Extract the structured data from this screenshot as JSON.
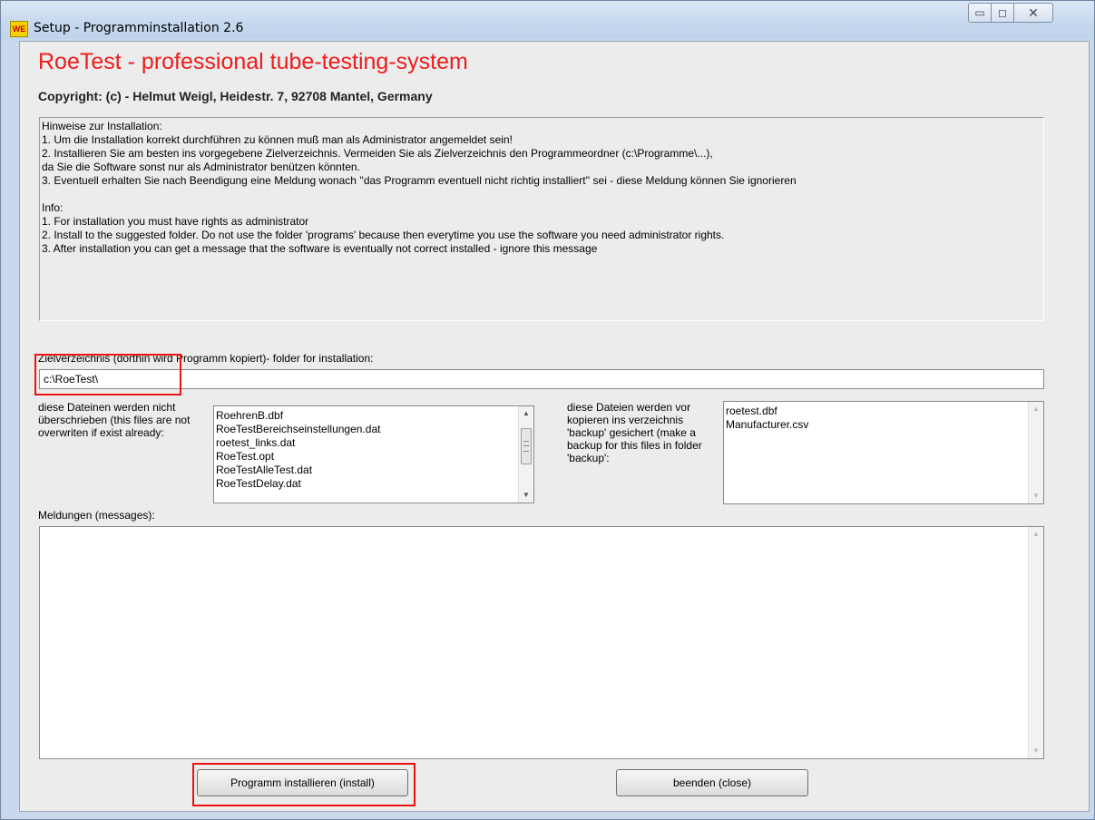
{
  "window": {
    "title": "Setup - Programminstallation  2.6",
    "icon": "app-icon",
    "controls": {
      "minimize": "▭",
      "maximize": "◻",
      "close": "✕"
    }
  },
  "header": {
    "heading": "RoeTest - professional tube-testing-system",
    "copyright": "Copyright: (c) - Helmut Weigl, Heidestr. 7, 92708 Mantel, Germany"
  },
  "notes": [
    "Hinweise zur Installation:",
    "1. Um die Installation korrekt durchführen zu können muß man als Administrator angemeldet sein!",
    "2. Installieren Sie am besten ins vorgegebene Zielverzeichnis. Vermeiden Sie als Zielverzeichnis den Programmeordner (c:\\Programme\\...),",
    "da Sie die Software sonst nur als Administrator benützen könnten.",
    "3. Eventuell erhalten Sie nach Beendigung eine Meldung wonach ''das Programm eventuell nicht richtig installiert'' sei - diese Meldung können Sie ignorieren",
    "",
    "Info:",
    "1. For installation you must have rights as administrator",
    "2. Install to the suggested folder. Do not use the folder 'programs' because then everytime you use the software you need administrator rights.",
    "3. After installation you can get a message that the software is eventually not correct installed - ignore this message"
  ],
  "target": {
    "label": "Zielverzeichnis (dorthin wird Programm kopiert)- folder for installation:",
    "value": "c:\\RoeTest\\"
  },
  "no_overwrite": {
    "label": "diese Dateinen werden nicht überschrieben (this files are not overwriten if exist already:",
    "files": [
      "RoehrenB.dbf",
      "RoeTestBereichseinstellungen.dat",
      "roetest_links.dat",
      "RoeTest.opt",
      "RoeTestAlleTest.dat",
      "RoeTestDelay.dat"
    ]
  },
  "backup": {
    "label": "diese Dateien werden vor kopieren ins verzeichnis 'backup' gesichert (make a backup for this files in folder 'backup':",
    "files": [
      "roetest.dbf",
      "Manufacturer.csv"
    ]
  },
  "messages": {
    "label": "Meldungen (messages):",
    "content": ""
  },
  "buttons": {
    "install": "Programm installieren (install)",
    "close": "beenden (close)"
  },
  "colors": {
    "heading": "#ee1c1c",
    "highlight": "#e11111"
  }
}
